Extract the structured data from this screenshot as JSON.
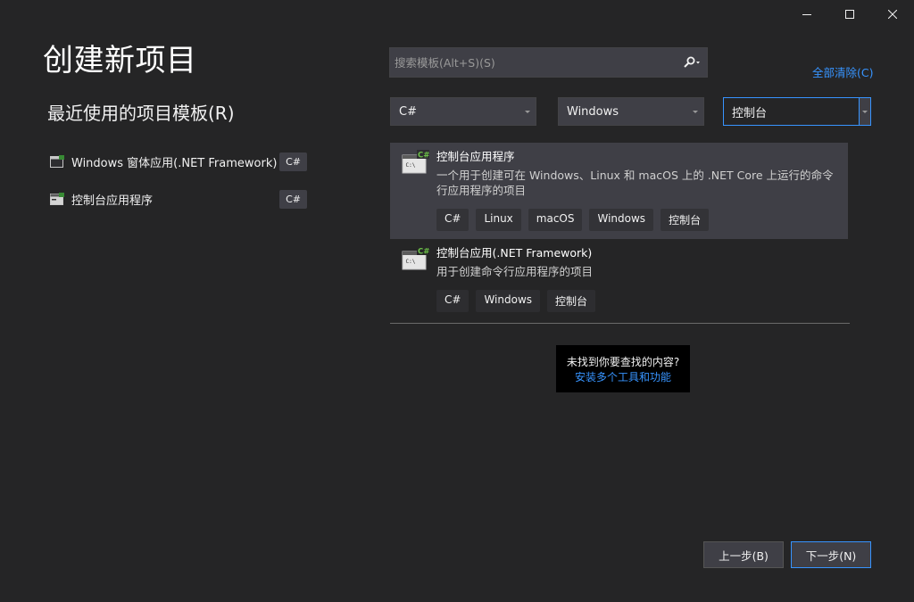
{
  "page_title": "创建新项目",
  "recent": {
    "heading": "最近使用的项目模板(R)",
    "items": [
      {
        "label": "Windows 窗体应用(.NET Framework)",
        "tag": "C#",
        "icon": "windows-form-icon"
      },
      {
        "label": "控制台应用程序",
        "tag": "C#",
        "icon": "console-app-icon"
      }
    ]
  },
  "search": {
    "placeholder": "搜索模板(Alt+S)(S)",
    "value": ""
  },
  "clear_all": "全部清除(C)",
  "filters": {
    "language": "C#",
    "platform": "Windows",
    "project_type": "控制台"
  },
  "results": [
    {
      "title": "控制台应用程序",
      "description": "一个用于创建可在 Windows、Linux 和 macOS 上的 .NET Core 上运行的命令行应用程序的项目",
      "tags": [
        "C#",
        "Linux",
        "macOS",
        "Windows",
        "控制台"
      ],
      "icon": "csharp-console-icon"
    },
    {
      "title": "控制台应用(.NET Framework)",
      "description": "用于创建命令行应用程序的项目",
      "tags": [
        "C#",
        "Windows",
        "控制台"
      ],
      "icon": "csharp-console-icon"
    }
  ],
  "not_found": {
    "question": "未找到你要查找的内容?",
    "link": "安装多个工具和功能"
  },
  "buttons": {
    "back": "上一步(B)",
    "next": "下一步(N)"
  },
  "colors": {
    "accent": "#3794ff",
    "background": "#252526",
    "csharp_badge": "#388a34"
  }
}
